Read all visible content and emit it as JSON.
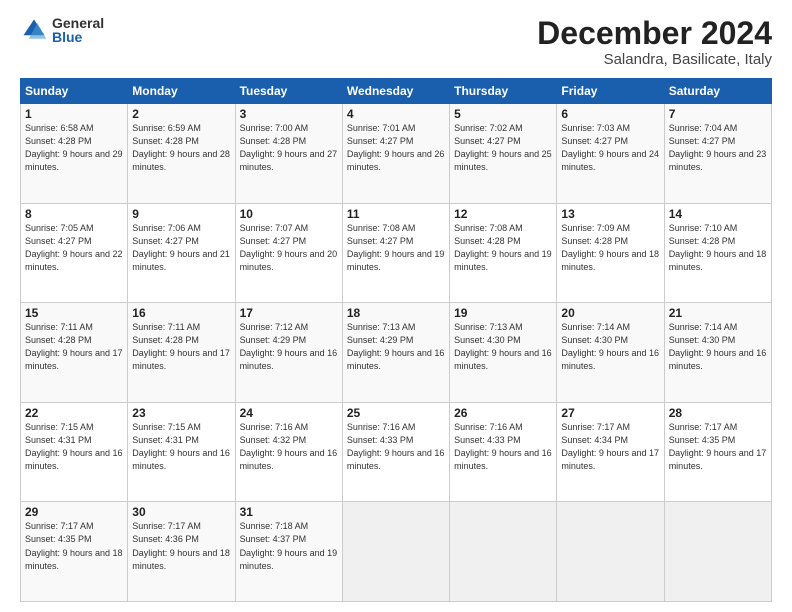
{
  "logo": {
    "general": "General",
    "blue": "Blue"
  },
  "title": "December 2024",
  "location": "Salandra, Basilicate, Italy",
  "days_header": [
    "Sunday",
    "Monday",
    "Tuesday",
    "Wednesday",
    "Thursday",
    "Friday",
    "Saturday"
  ],
  "weeks": [
    [
      {
        "day": "1",
        "sunrise": "6:58 AM",
        "sunset": "4:28 PM",
        "daylight": "9 hours and 29 minutes."
      },
      {
        "day": "2",
        "sunrise": "6:59 AM",
        "sunset": "4:28 PM",
        "daylight": "9 hours and 28 minutes."
      },
      {
        "day": "3",
        "sunrise": "7:00 AM",
        "sunset": "4:28 PM",
        "daylight": "9 hours and 27 minutes."
      },
      {
        "day": "4",
        "sunrise": "7:01 AM",
        "sunset": "4:27 PM",
        "daylight": "9 hours and 26 minutes."
      },
      {
        "day": "5",
        "sunrise": "7:02 AM",
        "sunset": "4:27 PM",
        "daylight": "9 hours and 25 minutes."
      },
      {
        "day": "6",
        "sunrise": "7:03 AM",
        "sunset": "4:27 PM",
        "daylight": "9 hours and 24 minutes."
      },
      {
        "day": "7",
        "sunrise": "7:04 AM",
        "sunset": "4:27 PM",
        "daylight": "9 hours and 23 minutes."
      }
    ],
    [
      {
        "day": "8",
        "sunrise": "7:05 AM",
        "sunset": "4:27 PM",
        "daylight": "9 hours and 22 minutes."
      },
      {
        "day": "9",
        "sunrise": "7:06 AM",
        "sunset": "4:27 PM",
        "daylight": "9 hours and 21 minutes."
      },
      {
        "day": "10",
        "sunrise": "7:07 AM",
        "sunset": "4:27 PM",
        "daylight": "9 hours and 20 minutes."
      },
      {
        "day": "11",
        "sunrise": "7:08 AM",
        "sunset": "4:27 PM",
        "daylight": "9 hours and 19 minutes."
      },
      {
        "day": "12",
        "sunrise": "7:08 AM",
        "sunset": "4:28 PM",
        "daylight": "9 hours and 19 minutes."
      },
      {
        "day": "13",
        "sunrise": "7:09 AM",
        "sunset": "4:28 PM",
        "daylight": "9 hours and 18 minutes."
      },
      {
        "day": "14",
        "sunrise": "7:10 AM",
        "sunset": "4:28 PM",
        "daylight": "9 hours and 18 minutes."
      }
    ],
    [
      {
        "day": "15",
        "sunrise": "7:11 AM",
        "sunset": "4:28 PM",
        "daylight": "9 hours and 17 minutes."
      },
      {
        "day": "16",
        "sunrise": "7:11 AM",
        "sunset": "4:28 PM",
        "daylight": "9 hours and 17 minutes."
      },
      {
        "day": "17",
        "sunrise": "7:12 AM",
        "sunset": "4:29 PM",
        "daylight": "9 hours and 16 minutes."
      },
      {
        "day": "18",
        "sunrise": "7:13 AM",
        "sunset": "4:29 PM",
        "daylight": "9 hours and 16 minutes."
      },
      {
        "day": "19",
        "sunrise": "7:13 AM",
        "sunset": "4:30 PM",
        "daylight": "9 hours and 16 minutes."
      },
      {
        "day": "20",
        "sunrise": "7:14 AM",
        "sunset": "4:30 PM",
        "daylight": "9 hours and 16 minutes."
      },
      {
        "day": "21",
        "sunrise": "7:14 AM",
        "sunset": "4:30 PM",
        "daylight": "9 hours and 16 minutes."
      }
    ],
    [
      {
        "day": "22",
        "sunrise": "7:15 AM",
        "sunset": "4:31 PM",
        "daylight": "9 hours and 16 minutes."
      },
      {
        "day": "23",
        "sunrise": "7:15 AM",
        "sunset": "4:31 PM",
        "daylight": "9 hours and 16 minutes."
      },
      {
        "day": "24",
        "sunrise": "7:16 AM",
        "sunset": "4:32 PM",
        "daylight": "9 hours and 16 minutes."
      },
      {
        "day": "25",
        "sunrise": "7:16 AM",
        "sunset": "4:33 PM",
        "daylight": "9 hours and 16 minutes."
      },
      {
        "day": "26",
        "sunrise": "7:16 AM",
        "sunset": "4:33 PM",
        "daylight": "9 hours and 16 minutes."
      },
      {
        "day": "27",
        "sunrise": "7:17 AM",
        "sunset": "4:34 PM",
        "daylight": "9 hours and 17 minutes."
      },
      {
        "day": "28",
        "sunrise": "7:17 AM",
        "sunset": "4:35 PM",
        "daylight": "9 hours and 17 minutes."
      }
    ],
    [
      {
        "day": "29",
        "sunrise": "7:17 AM",
        "sunset": "4:35 PM",
        "daylight": "9 hours and 18 minutes."
      },
      {
        "day": "30",
        "sunrise": "7:17 AM",
        "sunset": "4:36 PM",
        "daylight": "9 hours and 18 minutes."
      },
      {
        "day": "31",
        "sunrise": "7:18 AM",
        "sunset": "4:37 PM",
        "daylight": "9 hours and 19 minutes."
      },
      null,
      null,
      null,
      null
    ]
  ],
  "labels": {
    "sunrise_prefix": "Sunrise: ",
    "sunset_prefix": "Sunset: ",
    "daylight_prefix": "Daylight: "
  }
}
